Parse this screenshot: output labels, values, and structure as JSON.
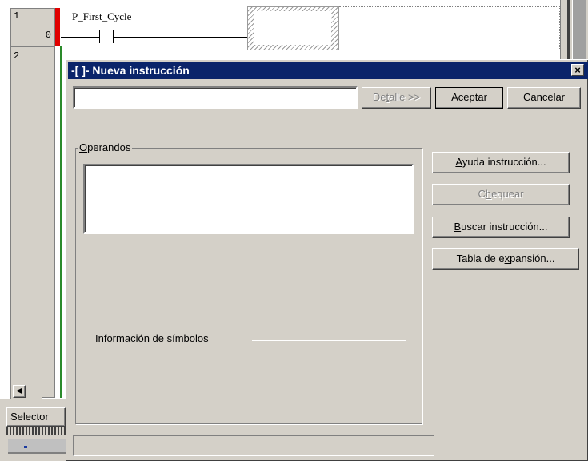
{
  "editor": {
    "rungs": [
      {
        "number": "1",
        "step": "0"
      },
      {
        "number": "2",
        "step": ""
      }
    ],
    "contact_label": "P_First_Cycle",
    "left_tab_label": "Selector"
  },
  "dialog": {
    "title": "-[ ]- Nueva instrucción",
    "close_glyph": "×",
    "instruction_input": {
      "value": "",
      "placeholder": ""
    },
    "detail_button": {
      "pre": "De",
      "key": "t",
      "post": "alle >>"
    },
    "accept_button": "Aceptar",
    "cancel_button": "Cancelar",
    "operands_group": {
      "key": "O",
      "rest": "perandos"
    },
    "operands_value": "",
    "help_button": {
      "key": "A",
      "rest": "yuda instrucción..."
    },
    "check_button": {
      "pre": "C",
      "key": "h",
      "post": "equear"
    },
    "search_button": {
      "key": "B",
      "rest": "uscar instrucción..."
    },
    "expansion_button": {
      "pre": "Tabla de e",
      "key": "x",
      "post": "pansión..."
    },
    "symbols_info_label": "Información de símbolos",
    "status_text": ""
  }
}
